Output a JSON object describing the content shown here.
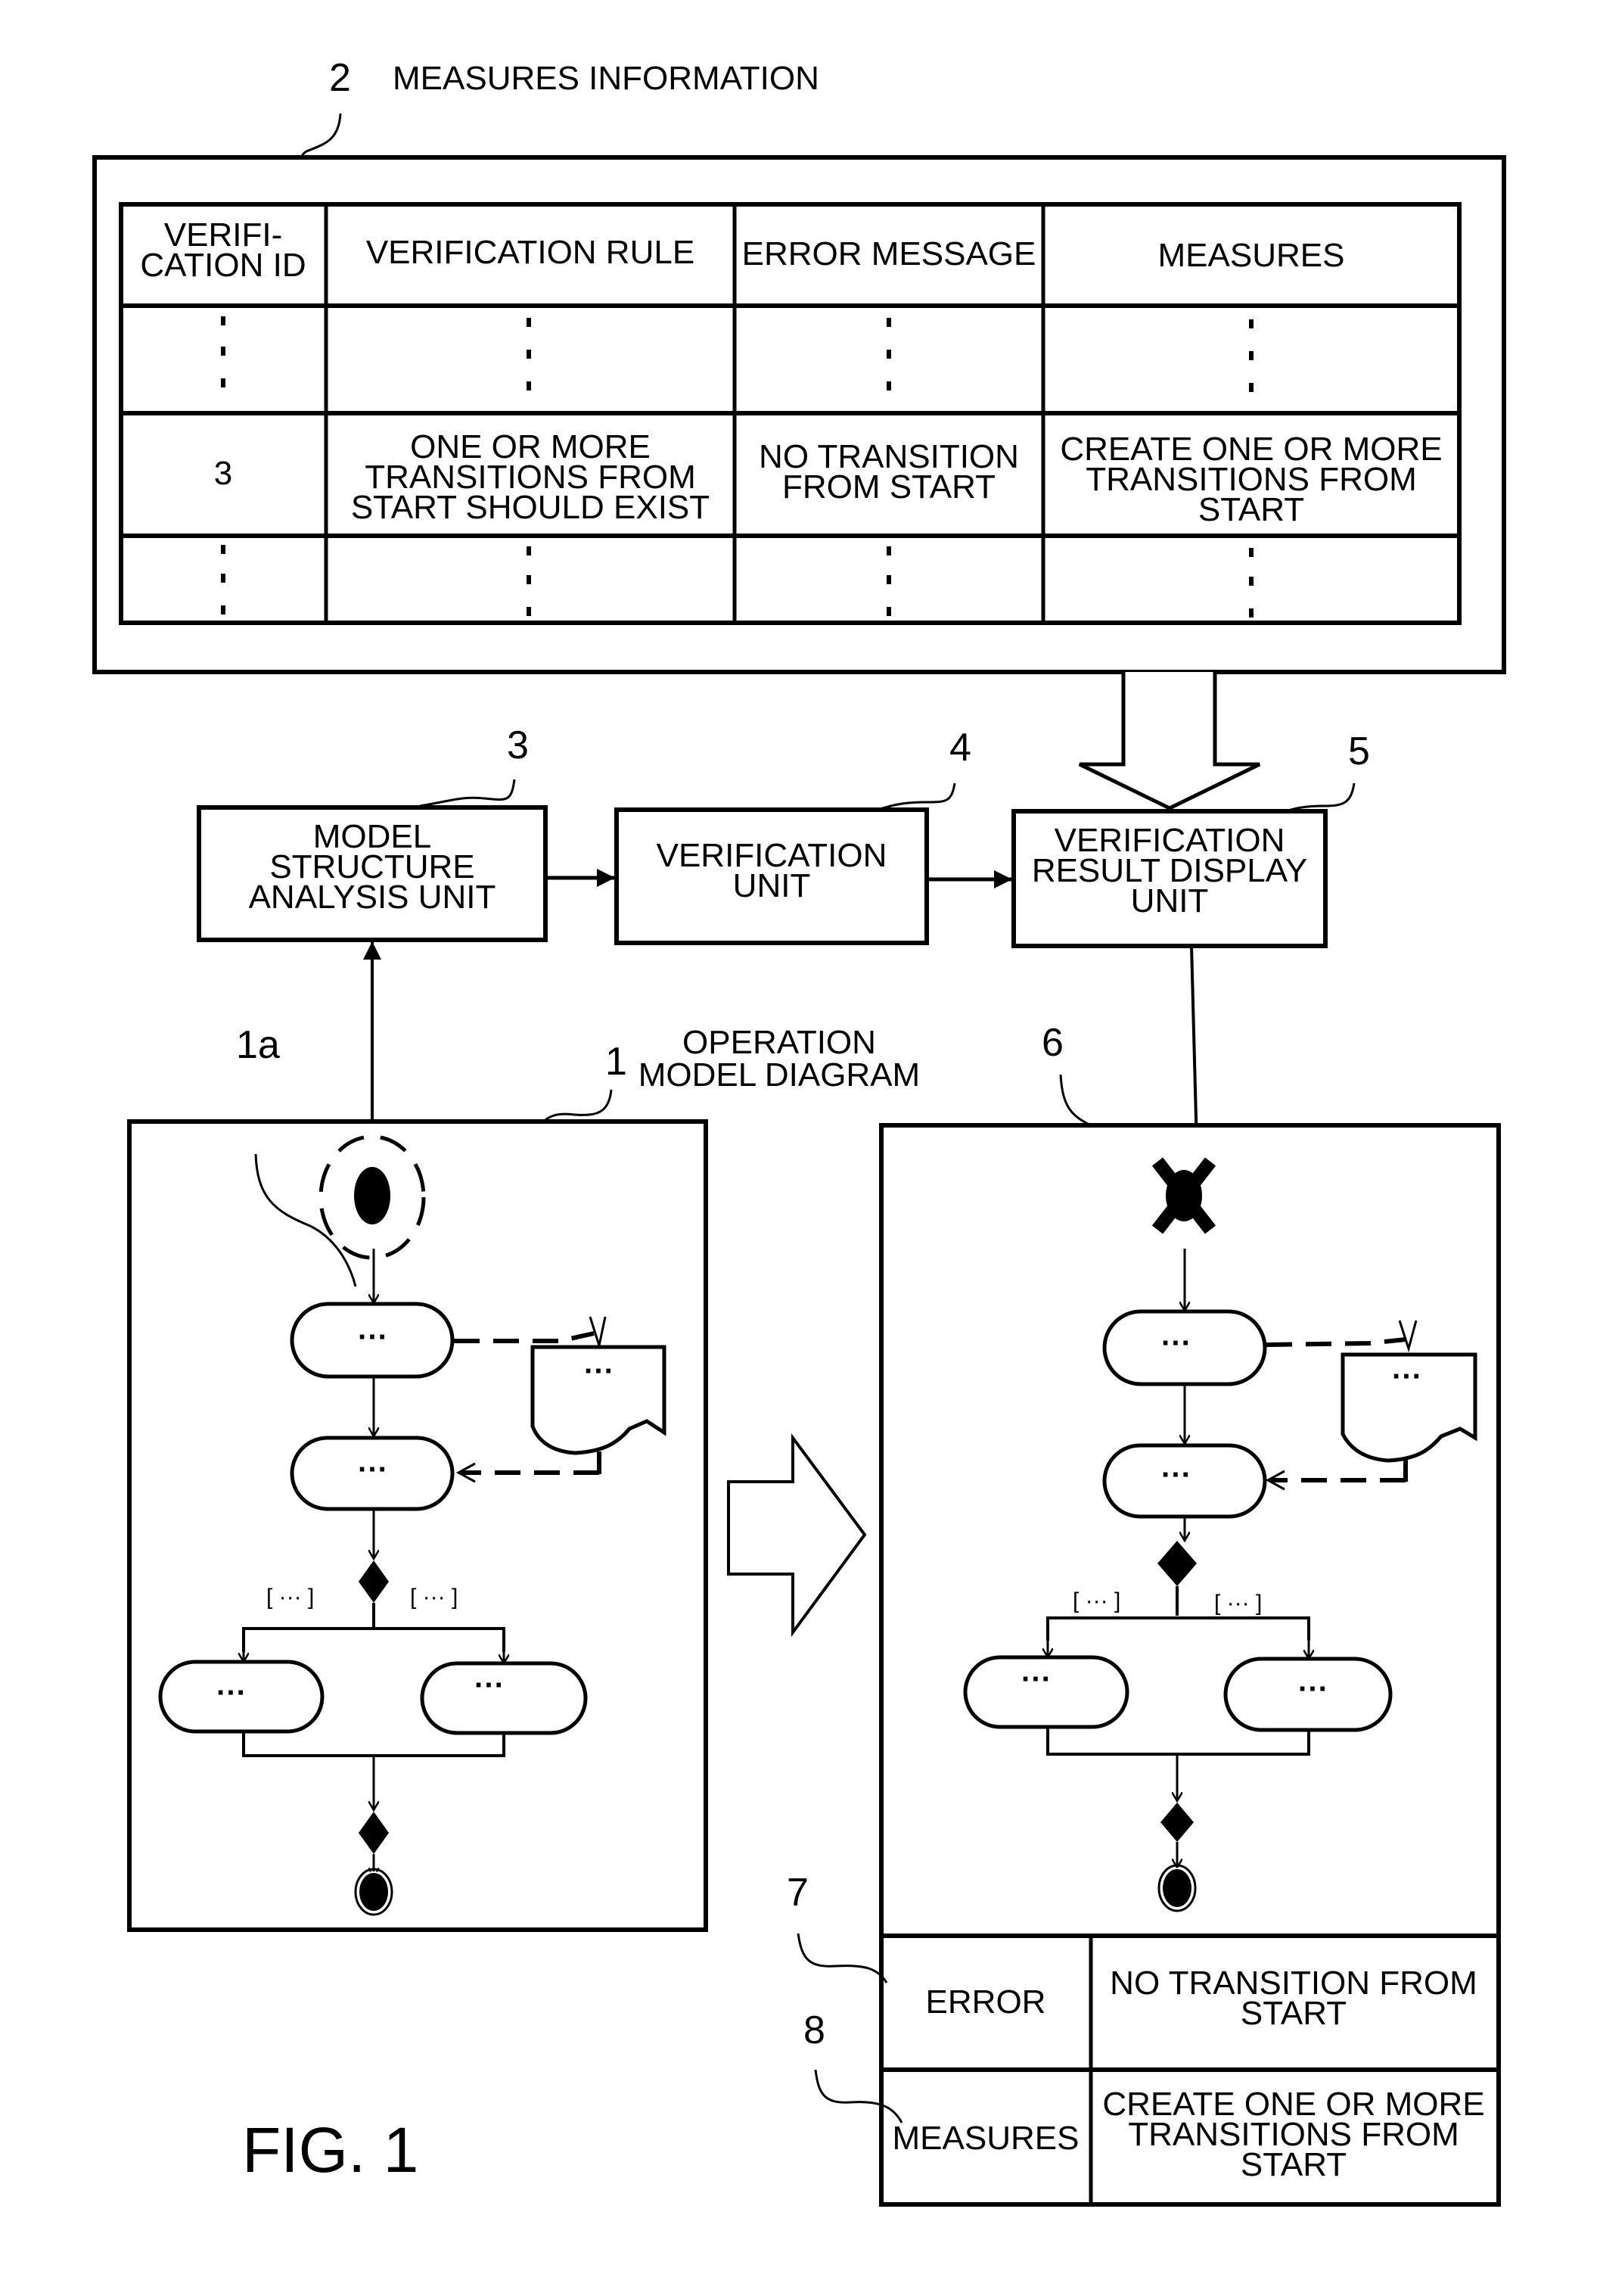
{
  "figure_label": "FIG. 1",
  "measures_information": {
    "ref": "2",
    "title": "MEASURES INFORMATION",
    "columns": [
      "VERIFI-",
      "CATION ID",
      "VERIFICATION RULE",
      "ERROR MESSAGE",
      "MEASURES"
    ],
    "header": {
      "id_line1": "VERIFI-",
      "id_line2": "CATION ID",
      "rule": "VERIFICATION RULE",
      "error": "ERROR MESSAGE",
      "measures": "MEASURES"
    },
    "ellipsis": ":",
    "row": {
      "id": "3",
      "rule_lines": [
        "ONE OR MORE",
        "TRANSITIONS FROM",
        "START SHOULD EXIST"
      ],
      "error_lines": [
        "NO TRANSITION",
        "FROM START"
      ],
      "measures_lines": [
        "CREATE ONE OR MORE",
        "TRANSITIONS FROM",
        "START"
      ]
    }
  },
  "units": {
    "model_structure": {
      "ref": "3",
      "lines": [
        "MODEL",
        "STRUCTURE",
        "ANALYSIS UNIT"
      ]
    },
    "verification": {
      "ref": "4",
      "lines": [
        "VERIFICATION",
        "UNIT"
      ]
    },
    "result_display": {
      "ref": "5",
      "lines": [
        "VERIFICATION",
        "RESULT DISPLAY",
        "UNIT"
      ]
    }
  },
  "operation_model": {
    "ref": "1",
    "start_ref": "1a",
    "title_lines": [
      "OPERATION",
      "MODEL DIAGRAM"
    ],
    "node_text": "···",
    "guard_text": "[ ··· ]"
  },
  "result_panel": {
    "error_marker_ref": "6",
    "error_row_ref": "7",
    "measures_row_ref": "8",
    "error_label": "ERROR",
    "error_lines": [
      "NO TRANSITION FROM",
      "START"
    ],
    "measures_label": "MEASURES",
    "measures_lines": [
      "CREATE ONE OR MORE",
      "TRANSITIONS FROM",
      "START"
    ]
  }
}
